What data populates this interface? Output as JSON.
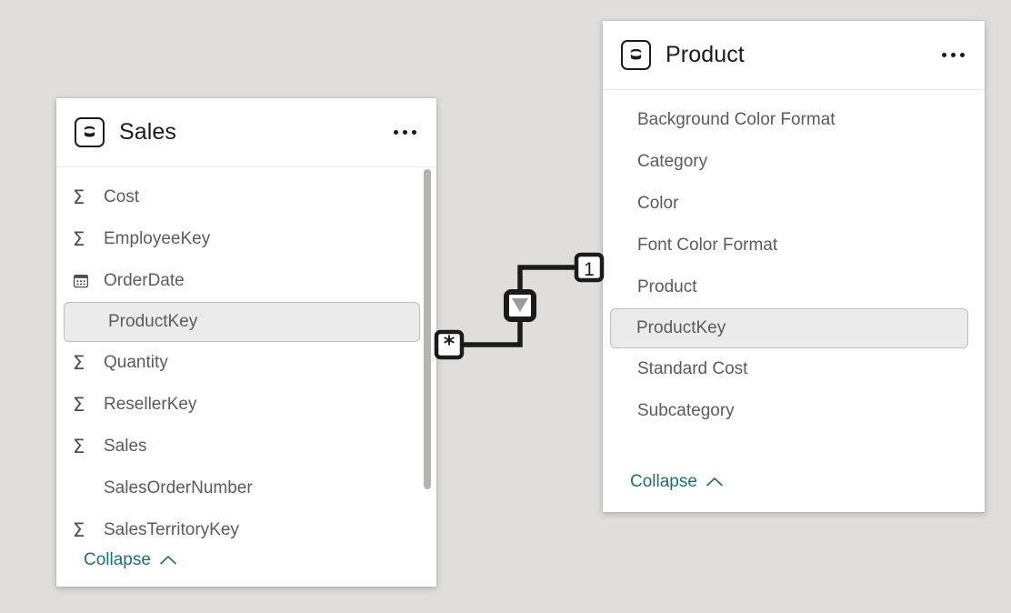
{
  "canvas": {
    "background_color": "#e0dedd"
  },
  "tables": [
    {
      "id": "sales",
      "title": "Sales",
      "icon": "table-database-icon",
      "menu_icon": "ellipsis-icon",
      "collapse_label": "Collapse",
      "collapse_icon": "chevron-up-icon",
      "scrollbar_visible": true,
      "fields": [
        {
          "label": "Cost",
          "icon": "sigma-icon",
          "selected": false
        },
        {
          "label": "EmployeeKey",
          "icon": "sigma-icon",
          "selected": false
        },
        {
          "label": "OrderDate",
          "icon": "calendar-icon",
          "selected": false
        },
        {
          "label": "ProductKey",
          "icon": "none",
          "selected": true
        },
        {
          "label": "Quantity",
          "icon": "sigma-icon",
          "selected": false
        },
        {
          "label": "ResellerKey",
          "icon": "sigma-icon",
          "selected": false
        },
        {
          "label": "Sales",
          "icon": "sigma-icon",
          "selected": false
        },
        {
          "label": "SalesOrderNumber",
          "icon": "none",
          "selected": false
        },
        {
          "label": "SalesTerritoryKey",
          "icon": "sigma-icon",
          "selected": false
        }
      ]
    },
    {
      "id": "product",
      "title": "Product",
      "icon": "table-database-icon",
      "menu_icon": "ellipsis-icon",
      "collapse_label": "Collapse",
      "collapse_icon": "chevron-up-icon",
      "scrollbar_visible": false,
      "fields": [
        {
          "label": "Background Color Format",
          "icon": "none",
          "selected": false
        },
        {
          "label": "Category",
          "icon": "none",
          "selected": false
        },
        {
          "label": "Color",
          "icon": "none",
          "selected": false
        },
        {
          "label": "Font Color Format",
          "icon": "none",
          "selected": false
        },
        {
          "label": "Product",
          "icon": "none",
          "selected": false
        },
        {
          "label": "ProductKey",
          "icon": "none",
          "selected": true
        },
        {
          "label": "Standard Cost",
          "icon": "none",
          "selected": false
        },
        {
          "label": "Subcategory",
          "icon": "none",
          "selected": false
        }
      ]
    }
  ],
  "relationship": {
    "from_table": "Sales",
    "from_column": "ProductKey",
    "to_table": "Product",
    "to_column": "ProductKey",
    "many_side_marker": "*",
    "one_side_marker": "1",
    "cardinality": "*:1",
    "cross_filter_direction_icon": "filter-direction-down-icon",
    "line_color": "#1b1b1b"
  },
  "theme": {
    "card_background": "#ffffff",
    "selected_row_background": "#ebebeb",
    "selected_row_border": "#bdbdbd",
    "link_color": "#1d6f73",
    "field_text_color": "#5b5b5b",
    "title_color": "#1b1b1b"
  }
}
